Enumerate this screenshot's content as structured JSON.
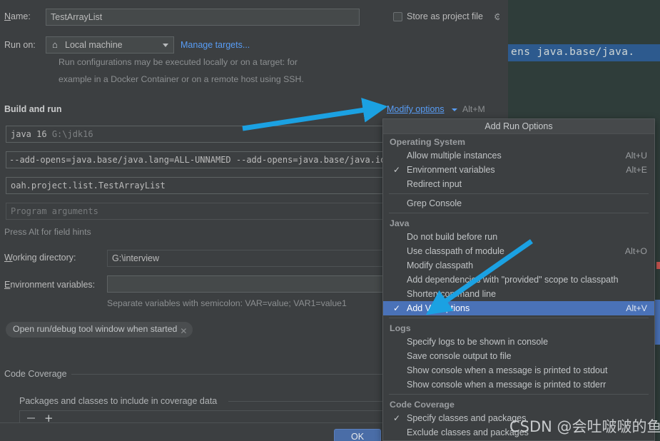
{
  "dialog": {
    "name_label": "Name:",
    "name_value": "TestArrayList",
    "store_as_project_file_label": "Store as project file",
    "gear_icon": "gear-icon",
    "run_on_label": "Run on:",
    "run_on_value": "Local machine",
    "manage_targets_link": "Manage targets...",
    "run_on_hint_line1": "Run configurations may be executed locally or on a target: for",
    "run_on_hint_line2": "example in a Docker Container or on a remote host using SSH.",
    "build_and_run_title": "Build and run",
    "modify_options_link": "Modify options",
    "modify_options_accel": "Alt+M",
    "jdk_value": "java 16",
    "jdk_path": "G:\\jdk16",
    "vm_options_value": "--add-opens=java.base/java.lang=ALL-UNNAMED --add-opens=java.base/java.io=A",
    "main_class_value": "oah.project.list.TestArrayList",
    "program_arguments_placeholder": "Program arguments",
    "field_hints": "Press Alt for field hints",
    "working_directory_label": "Working directory:",
    "working_directory_value": "G:\\interview",
    "environment_variables_label": "Environment variables:",
    "environment_variables_value": "",
    "environment_variables_hint": "Separate variables with semicolon: VAR=value; VAR1=value1",
    "open_tool_window_chip": "Open run/debug tool window when started",
    "code_coverage_group": "Code Coverage",
    "packages_group": "Packages and classes to include in coverage data",
    "minus_button": "−",
    "plus_button": "+",
    "ok_button": "OK"
  },
  "menu": {
    "title": "Add Run Options",
    "sections": [
      {
        "group": "Operating System",
        "items": [
          {
            "label": "Allow multiple instances",
            "accel": "Alt+U",
            "checked": false,
            "selected": false
          },
          {
            "label": "Environment variables",
            "accel": "Alt+E",
            "checked": true,
            "selected": false
          },
          {
            "label": "Redirect input",
            "accel": "",
            "checked": false,
            "selected": false
          }
        ],
        "separator_after": true
      },
      {
        "group": "",
        "items": [
          {
            "label": "Grep Console",
            "accel": "",
            "checked": false,
            "selected": false
          }
        ],
        "separator_after": true
      },
      {
        "group": "Java",
        "items": [
          {
            "label": "Do not build before run",
            "accel": "",
            "checked": false,
            "selected": false
          },
          {
            "label": "Use classpath of module",
            "accel": "Alt+O",
            "checked": false,
            "selected": false
          },
          {
            "label": "Modify classpath",
            "accel": "",
            "checked": false,
            "selected": false
          },
          {
            "label": "Add dependencies with \"provided\" scope to classpath",
            "accel": "",
            "checked": false,
            "selected": false
          },
          {
            "label": "Shorten command line",
            "accel": "",
            "checked": false,
            "selected": false
          },
          {
            "label": "Add VM options",
            "accel": "Alt+V",
            "checked": true,
            "selected": true
          }
        ],
        "separator_after": true
      },
      {
        "group": "Logs",
        "items": [
          {
            "label": "Specify logs to be shown in console",
            "accel": "",
            "checked": false,
            "selected": false
          },
          {
            "label": "Save console output to file",
            "accel": "",
            "checked": false,
            "selected": false
          },
          {
            "label": "Show console when a message is printed to stdout",
            "accel": "",
            "checked": false,
            "selected": false
          },
          {
            "label": "Show console when a message is printed to stderr",
            "accel": "",
            "checked": false,
            "selected": false
          }
        ],
        "separator_after": true
      },
      {
        "group": "Code Coverage",
        "items": [
          {
            "label": "Specify classes and packages",
            "accel": "",
            "checked": true,
            "selected": false
          },
          {
            "label": "Exclude classes and packages",
            "accel": "",
            "checked": false,
            "selected": false
          }
        ],
        "separator_after": false
      }
    ]
  },
  "editor": {
    "visible_code_line": "ens java.base/java."
  },
  "watermark": "CSDN @会吐啵啵的鱼",
  "colors": {
    "dialog_bg": "#3c3f41",
    "field_bg": "#45494a",
    "accent_link": "#589df6",
    "selection_blue": "#4a72b8",
    "arrow_blue": "#1ba1e2",
    "editor_bg": "#2b3836",
    "ok_button": "#4a6da7"
  }
}
